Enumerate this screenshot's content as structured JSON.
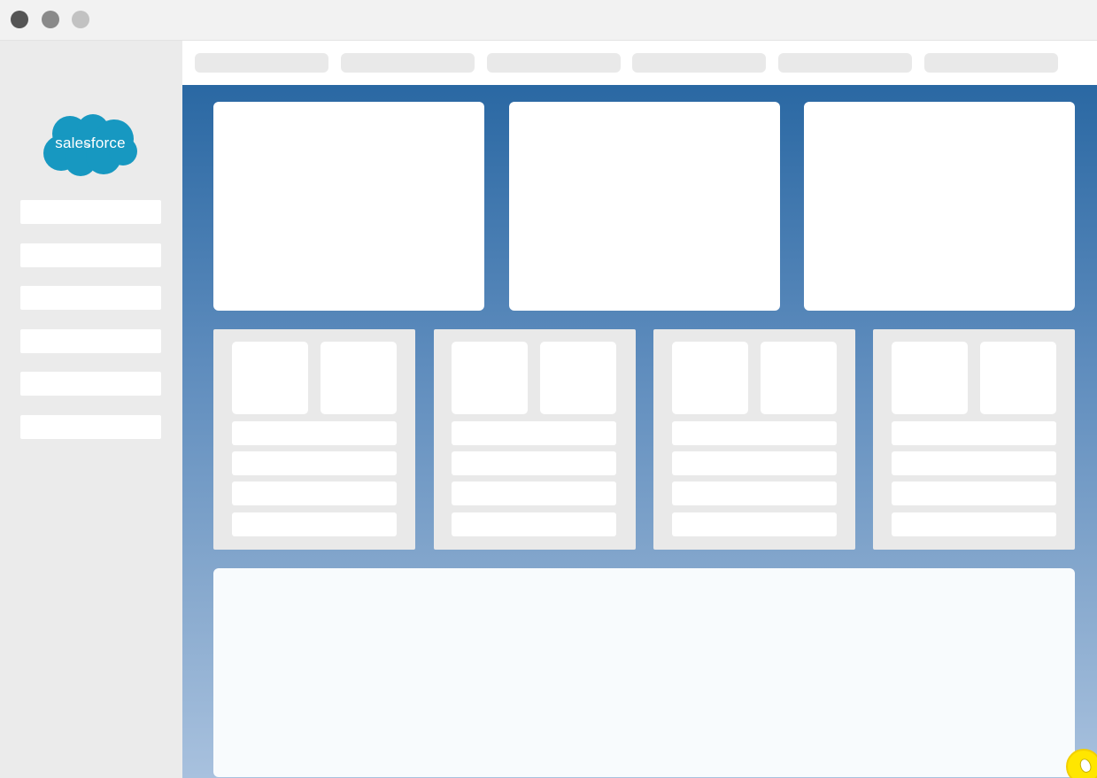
{
  "window": {
    "controls": [
      {
        "name": "close",
        "color": "#555555"
      },
      {
        "name": "minimize",
        "color": "#8a8a8a"
      },
      {
        "name": "maximize",
        "color": "#c2c2c2"
      }
    ]
  },
  "sidebar": {
    "logo": {
      "text": "salesforce",
      "color": "#1798c1"
    },
    "item_count": 6
  },
  "topnav": {
    "tab_count": 6
  },
  "main": {
    "gradient_top": "#2a68a3",
    "gradient_bottom": "#a8c1de",
    "top_card_count": 3,
    "panel_count": 4,
    "panel_rows": 4
  },
  "help_button": {
    "color": "#ffe600"
  }
}
